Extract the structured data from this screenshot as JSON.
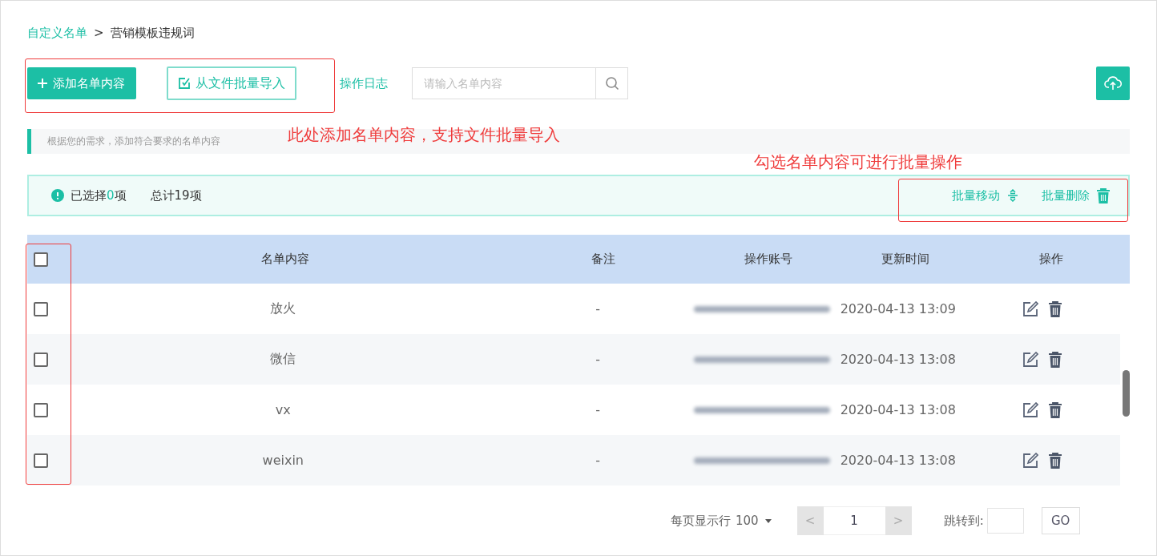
{
  "breadcrumb": {
    "parent": "自定义名单",
    "separator": ">",
    "current": "营销模板违规词"
  },
  "toolbar": {
    "add_button": "添加名单内容",
    "import_button": "从文件批量导入",
    "log_link": "操作日志",
    "search": {
      "placeholder": "请输入名单内容"
    }
  },
  "hint": "根据您的需求，添加符合要求的名单内容",
  "selection_bar": {
    "selected_prefix": "已选择",
    "selected_count": "0",
    "selected_suffix": "项",
    "total": "总计19项",
    "actions": [
      {
        "label": "批量移动",
        "kind": "move"
      },
      {
        "label": "批量删除",
        "kind": "delete"
      }
    ]
  },
  "table": {
    "header_checkbox": {
      "checked": false
    },
    "columns": [
      "名单内容",
      "备注",
      "操作账号",
      "更新时间",
      "操作"
    ],
    "rows": [
      {
        "content": "放火",
        "remark": "-",
        "updated": "2020-04-13 13:09",
        "checked": false
      },
      {
        "content": "微信",
        "remark": "-",
        "updated": "2020-04-13 13:08",
        "checked": false
      },
      {
        "content": "vx",
        "remark": "-",
        "updated": "2020-04-13 13:08",
        "checked": false
      },
      {
        "content": "weixin",
        "remark": "-",
        "updated": "2020-04-13 13:08",
        "checked": false
      }
    ]
  },
  "pagination": {
    "rows_per_page_label": "每页显示行",
    "rows_per_page": "100",
    "prev": "<",
    "page": "1",
    "next": ">",
    "jump_label": "跳转到:",
    "go_button": "GO"
  },
  "annotations": [
    "此处添加名单内容，支持文件批量导入",
    "勾选名单内容可进行批量操作"
  ]
}
